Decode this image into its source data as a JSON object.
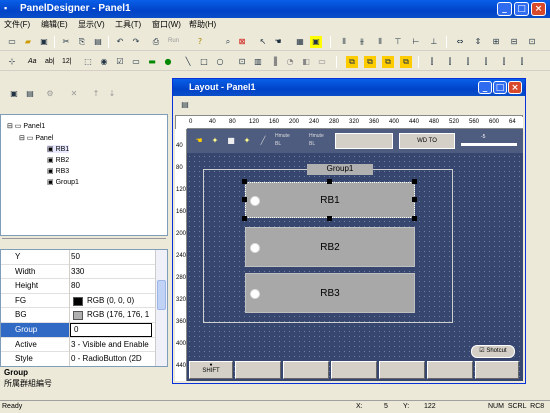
{
  "app": {
    "title": "PanelDesigner - Panel1",
    "min": "_",
    "max": "□",
    "close": "×"
  },
  "menu": [
    "文件(F)",
    "编辑(E)",
    "显示(V)",
    "工具(T)",
    "窗口(W)",
    "帮助(H)"
  ],
  "toolbar1": {
    "run": "Run"
  },
  "toolbar2": {
    "font": "Aa",
    "abl": "ab|",
    "num": "12|"
  },
  "tree": {
    "root": "Panel1",
    "child": "Panel",
    "items": [
      "RB1",
      "RB2",
      "RB3",
      "Group1"
    ]
  },
  "properties": [
    {
      "key": "Y",
      "value": "50"
    },
    {
      "key": "Width",
      "value": "330"
    },
    {
      "key": "Height",
      "value": "80"
    },
    {
      "key": "FG",
      "value": "RGB (0, 0, 0)",
      "swatch": "#000000"
    },
    {
      "key": "BG",
      "value": "RGB (176, 176, 1",
      "swatch": "#b0b0b0"
    },
    {
      "key": "Group",
      "value": "0"
    },
    {
      "key": "Active",
      "value": "3 - Visible and Enable"
    },
    {
      "key": "Style",
      "value": "0 - RadioButton (2D"
    }
  ],
  "description": {
    "title": "Group",
    "text": "所属群組編号"
  },
  "status": {
    "ready": "Ready",
    "x_label": "X:",
    "x": "5",
    "y_label": "Y:",
    "y": "122",
    "flags": "NUM  SCRL  RC8"
  },
  "layout": {
    "title": "Layout - Panel1",
    "ruler_h": [
      "0",
      "40",
      "80",
      "120",
      "160",
      "200",
      "240",
      "280",
      "320",
      "360",
      "400",
      "440",
      "480",
      "520",
      "560",
      "600",
      "64"
    ],
    "ruler_v": [
      "40",
      "80",
      "120",
      "160",
      "200",
      "240",
      "280",
      "320",
      "360",
      "400",
      "440"
    ]
  },
  "panel": {
    "group_label": "Group1",
    "buttons": [
      "RB1",
      "RB2",
      "RB3"
    ],
    "wd_label": "WD TO",
    "shotcut": "Shotcut",
    "shift": "SHIFT",
    "hmute": "Hmute",
    "bl": "BL",
    "slider_label": "-5"
  }
}
